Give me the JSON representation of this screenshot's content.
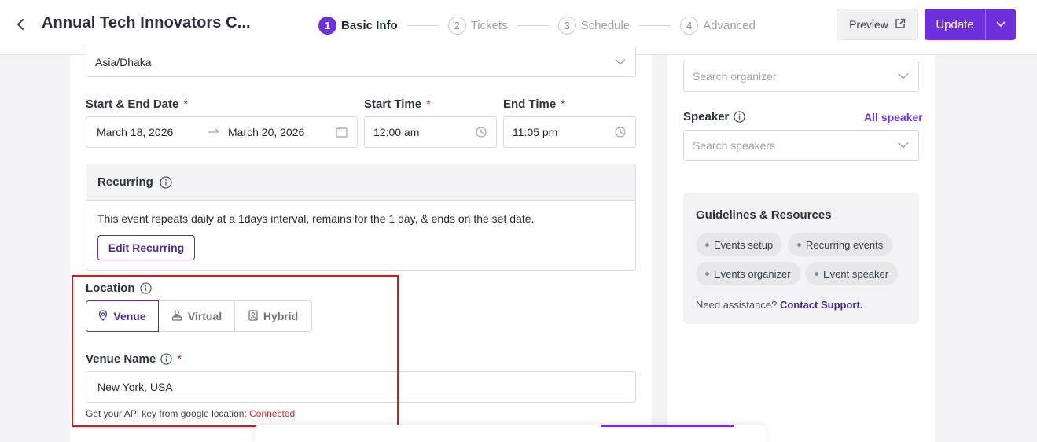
{
  "header": {
    "title": "Annual Tech Innovators C...",
    "steps": [
      {
        "num": "1",
        "label": "Basic Info"
      },
      {
        "num": "2",
        "label": "Tickets"
      },
      {
        "num": "3",
        "label": "Schedule"
      },
      {
        "num": "4",
        "label": "Advanced"
      }
    ],
    "active_step": 1,
    "preview_label": "Preview",
    "update_label": "Update"
  },
  "form": {
    "timezone_value": "Asia/Dhaka",
    "date_label": "Start & End Date",
    "start_date": "March 18, 2026",
    "end_date": "March 20, 2026",
    "start_time_label": "Start Time",
    "start_time": "12:00 am",
    "end_time_label": "End Time",
    "end_time": "11:05 pm",
    "required_mark": "*",
    "recurring": {
      "title": "Recurring",
      "description": "This event repeats daily at a 1days interval, remains for the 1 day, & ends on the set date.",
      "edit_label": "Edit Recurring"
    },
    "location": {
      "label": "Location",
      "options": [
        "Venue",
        "Virtual",
        "Hybrid"
      ],
      "selected": "Venue"
    },
    "venue": {
      "label": "Venue Name",
      "value": "New York, USA",
      "hint_prefix": "Get your API key from google location:",
      "hint_status": "Connected"
    }
  },
  "sidebar": {
    "organizer_placeholder": "Search organizer",
    "speaker_label": "Speaker",
    "all_speaker_label": "All speaker",
    "speaker_placeholder": "Search speakers",
    "guidelines": {
      "title": "Guidelines & Resources",
      "chips": [
        "Events setup",
        "Recurring events",
        "Events organizer",
        "Event speaker"
      ],
      "assist_text": "Need assistance?",
      "assist_link": "Contact Support."
    }
  },
  "colors": {
    "accent": "#6e2fdc",
    "required": "#dc2626",
    "highlight": "#e0151b"
  }
}
